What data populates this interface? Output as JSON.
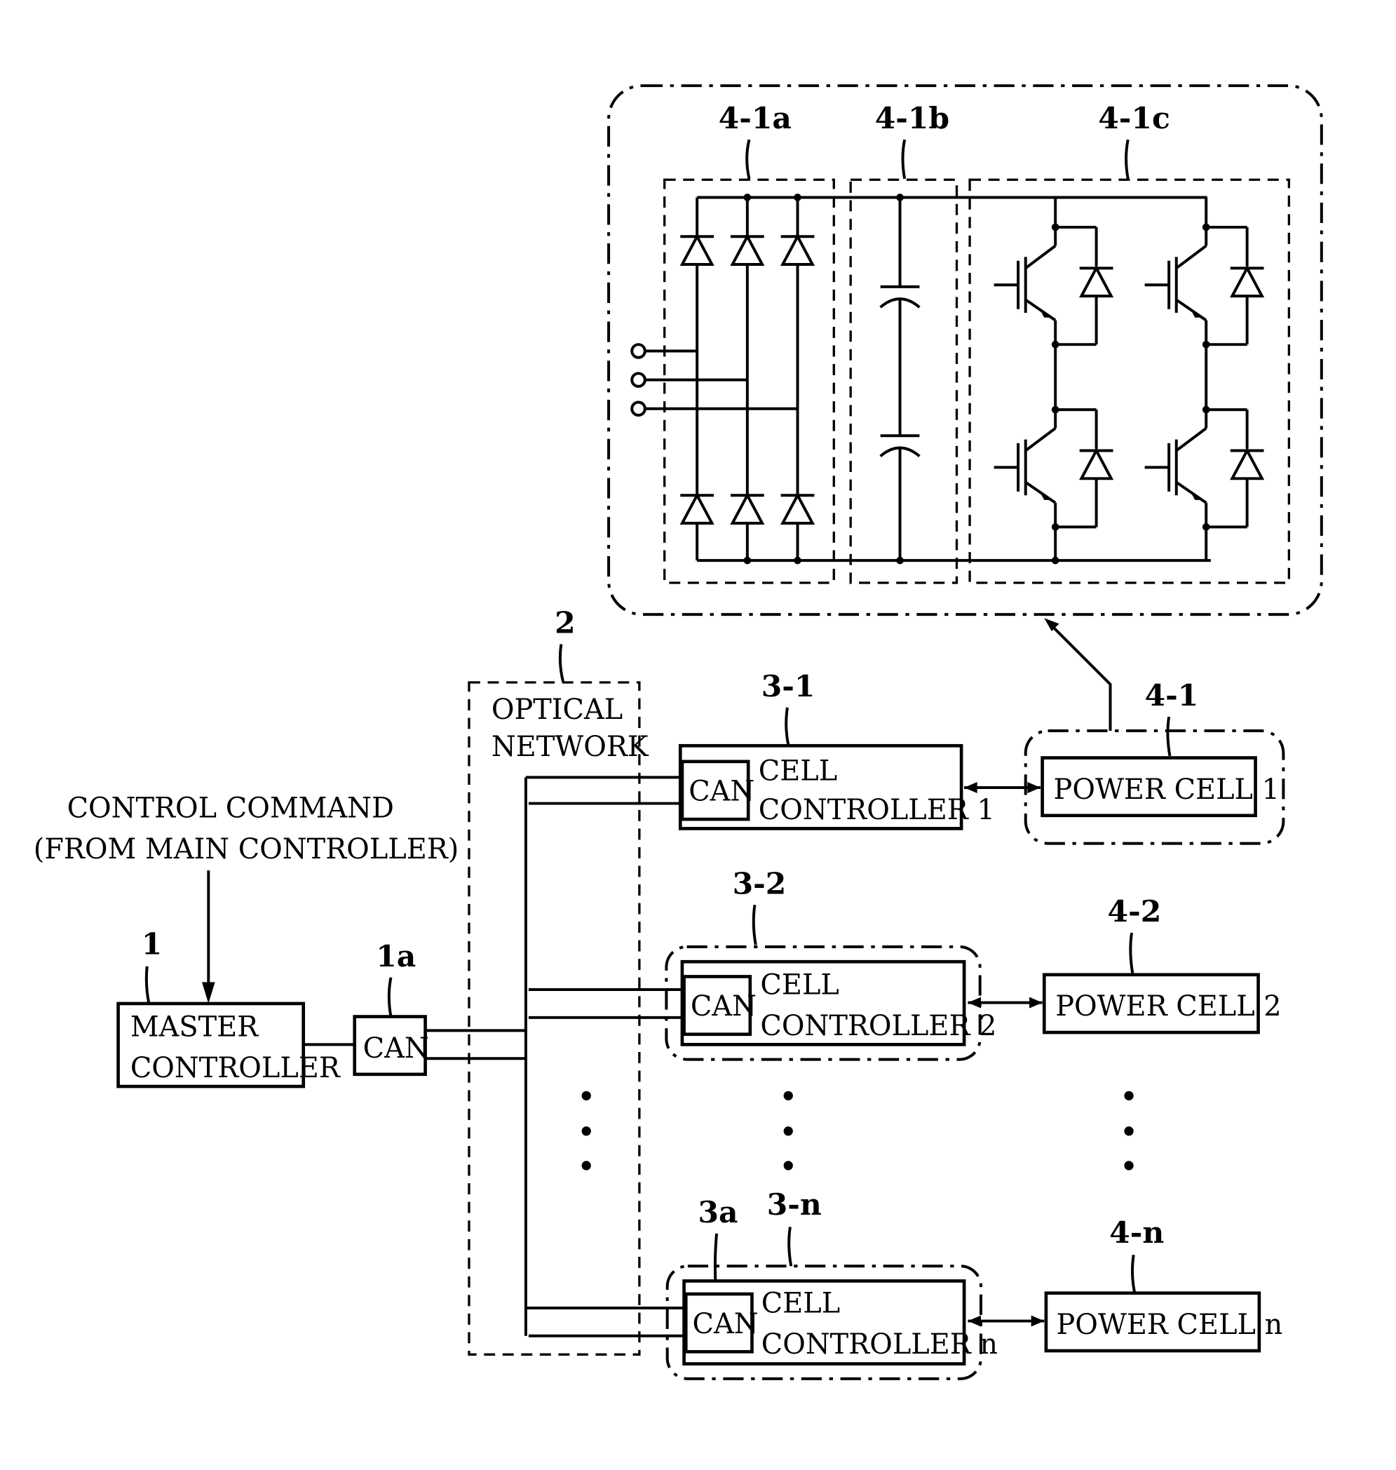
{
  "diagram": {
    "control_command": [
      "CONTROL COMMAND",
      "(FROM MAIN CONTROLLER)"
    ],
    "master": {
      "ref": "1",
      "lines": [
        "MASTER",
        "CONTROLLER"
      ]
    },
    "master_can": {
      "ref": "1a",
      "label": "CAN"
    },
    "network": {
      "ref": "2",
      "lines": [
        "OPTICAL",
        "NETWORK"
      ]
    },
    "cell_controllers": [
      {
        "ref": "3-1",
        "can": "CAN",
        "lines": [
          "CELL",
          "CONTROLLER 1"
        ]
      },
      {
        "ref": "3-2",
        "can": "CAN",
        "lines": [
          "CELL",
          "CONTROLLER 2"
        ]
      },
      {
        "ref": "3-n",
        "can_ref": "3a",
        "can": "CAN",
        "lines": [
          "CELL",
          "CONTROLLER n"
        ]
      }
    ],
    "power_cells": [
      {
        "ref": "4-1",
        "label": "POWER CELL 1"
      },
      {
        "ref": "4-2",
        "label": "POWER CELL 2"
      },
      {
        "ref": "4-n",
        "label": "POWER CELL n"
      }
    ],
    "detail": {
      "rectifier_ref": "4-1a",
      "dc_link_ref": "4-1b",
      "inverter_ref": "4-1c"
    },
    "ellipsis": "⋮"
  }
}
